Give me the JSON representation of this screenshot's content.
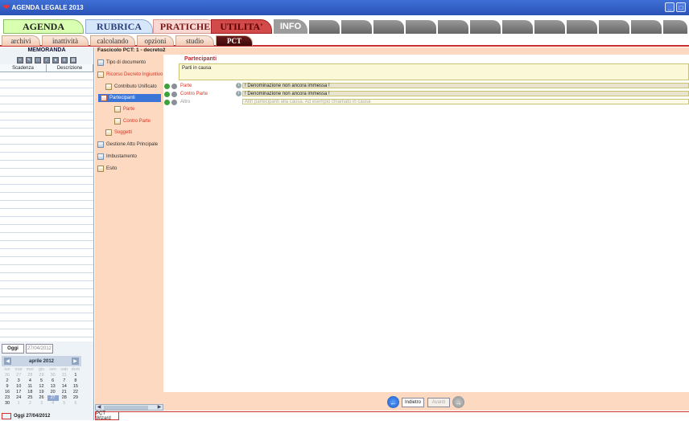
{
  "window": {
    "title": "AGENDA LEGALE 2013",
    "controls": [
      "minimize",
      "restore"
    ]
  },
  "main_tabs": [
    {
      "label": "AGENDA",
      "color": "#d9ffb0",
      "text_color": "#222"
    },
    {
      "label": "RUBRICA",
      "color": "#d7e7fb",
      "text_color": "#2a3f7a"
    },
    {
      "label": "PRATICHE",
      "color": "#f9d7d2",
      "text_color": "#7a1818"
    },
    {
      "label": "UTILITA'",
      "color": "#d24a4a",
      "text_color": "#5a0000"
    },
    {
      "label": "INFO",
      "color": "#9c9c9c",
      "text_color": "#ffffff"
    }
  ],
  "sub_tabs": [
    {
      "label": "archivi"
    },
    {
      "label": "inattività"
    },
    {
      "label": "calcolando"
    },
    {
      "label": "opzioni"
    },
    {
      "label": "studio"
    },
    {
      "label": "PCT"
    }
  ],
  "memoranda": {
    "title": "MEMORANDA",
    "columns": [
      "Scadenza",
      "Descrizione"
    ],
    "oggi_button": "Oggi",
    "oggi_date": "27/04/2012",
    "calendar": {
      "month": "aprile 2012",
      "weekdays": [
        "lun",
        "mar",
        "mer",
        "gio",
        "ven",
        "sab",
        "dom"
      ],
      "days": [
        "26",
        "27",
        "28",
        "29",
        "30",
        "31",
        "1",
        "2",
        "3",
        "4",
        "5",
        "6",
        "7",
        "8",
        "9",
        "10",
        "11",
        "12",
        "13",
        "14",
        "15",
        "16",
        "17",
        "18",
        "19",
        "20",
        "21",
        "22",
        "23",
        "24",
        "25",
        "26",
        "27",
        "28",
        "29",
        "30",
        "1",
        "2",
        "3",
        "4",
        "5",
        "6"
      ],
      "today": "Oggi 27/04/2012"
    }
  },
  "fascicolo": {
    "title": "Fascicolo PCT: 1 - decreto2",
    "nav": [
      {
        "label": "Tipo di documento",
        "style": "normal"
      },
      {
        "label": "Ricorso Decreto Ingiuntivo",
        "style": "red"
      },
      {
        "label": "Contributo Unificato",
        "style": "normal"
      },
      {
        "label": "Partecipanti",
        "style": "selected"
      },
      {
        "label": "Parte",
        "style": "red"
      },
      {
        "label": "Contro Parte",
        "style": "red"
      },
      {
        "label": "Soggetti",
        "style": "red"
      },
      {
        "label": "Gestione Atto Principale",
        "style": "normal"
      },
      {
        "label": "Imbustamento",
        "style": "normal"
      },
      {
        "label": "Esito",
        "style": "normal"
      }
    ],
    "bottom_tab": "PCT Wizard"
  },
  "partecipanti": {
    "title": "Partecipanti",
    "description": "Parti in causa",
    "rows": [
      {
        "label": "Parte",
        "value": "! Denominazione non ancora immessa !"
      },
      {
        "label": "Contro Parte",
        "value": "! Denominazione non ancora immessa !"
      },
      {
        "label": "Altro",
        "value": "Altri partecipanti alla causa. Ad esempio chiamato in causa"
      }
    ]
  },
  "footer": {
    "back_label": "Indietro",
    "next_label": "Avanti"
  }
}
